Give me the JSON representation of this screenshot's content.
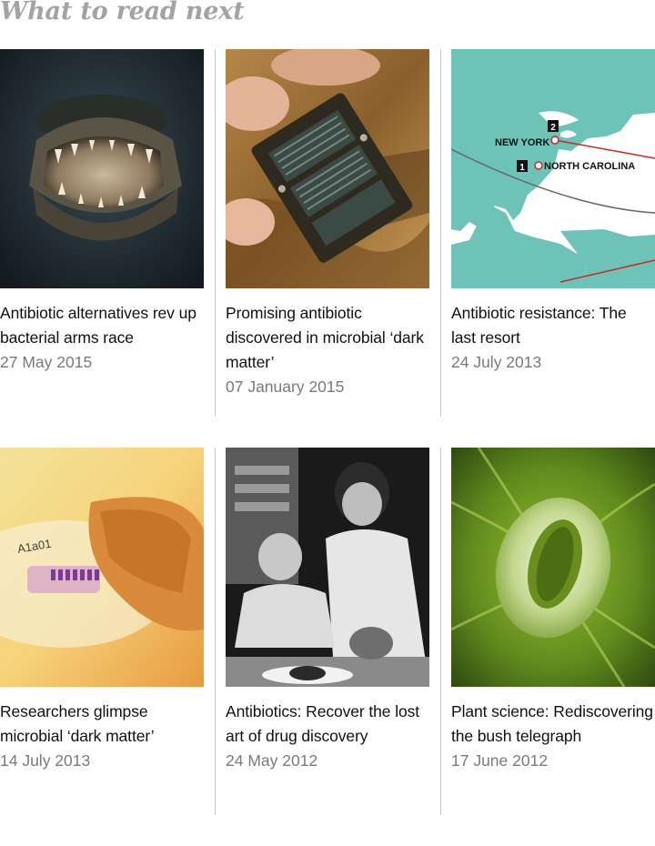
{
  "section": {
    "heading": "What to read next"
  },
  "articles": [
    {
      "title": "Antibiotic alternatives rev up bacterial arms race",
      "date": "27 May 2015",
      "image": "alligator-jaws-photo"
    },
    {
      "title": "Promising antibiotic discovered in microbial ‘dark matter’",
      "date": "07 January 2015",
      "image": "soil-chip-device-photo"
    },
    {
      "title": "Antibiotic resistance: The last resort",
      "date": "24 July 2013",
      "image": "americas-map",
      "map_labels": {
        "marker_1": "1",
        "marker_2": "2",
        "label_1": "NORTH CAROLINA",
        "label_2": "NEW YORK"
      }
    },
    {
      "title": "Researchers glimpse microbial ‘dark matter’",
      "date": "14 July 2013",
      "image": "petri-dish-photo",
      "dish_label": "A1a01"
    },
    {
      "title": "Antibiotics: Recover the lost art of drug discovery",
      "date": "24 May 2012",
      "image": "scientists-lab-photo"
    },
    {
      "title": "Plant science: Rediscovering the bush telegraph",
      "date": "17 June 2012",
      "image": "plant-stoma-micrograph"
    }
  ],
  "colors": {
    "heading": "#a3a3a3",
    "title": "#111111",
    "date": "#7a7a7a",
    "divider": "#c8c8c8",
    "map_sea": "#ffffff",
    "map_land": "#6ec3b8",
    "map_route": "#c62828"
  }
}
